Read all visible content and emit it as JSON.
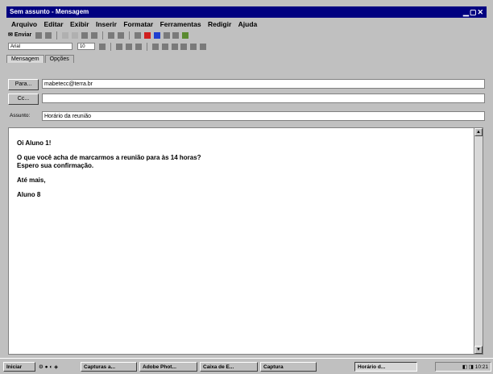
{
  "window": {
    "title": "Sem assunto - Mensagem",
    "controls": "▁▢✕"
  },
  "menu": [
    "Arquivo",
    "Editar",
    "Exibir",
    "Inserir",
    "Formatar",
    "Ferramentas",
    "Redigir",
    "Ajuda"
  ],
  "toolbar": {
    "send_label": "Enviar",
    "font_name": "Arial",
    "font_size": "10"
  },
  "tabs": [
    "Mensagem",
    "Opções"
  ],
  "header": {
    "to_label": "Para...",
    "to_value": "mabetecc@terra.br",
    "cc_label": "Cc...",
    "cc_value": "",
    "subject_label": "Assunto:",
    "subject_value": "Horário da reunião"
  },
  "message": {
    "lines": [
      "Oi Aluno 1!",
      "",
      "O que você acha de marcarmos a reunião para às 14 horas?",
      "Espero sua confirmação.",
      "",
      "Até mais,",
      "",
      "Aluno 8"
    ]
  },
  "taskbar": {
    "start_label": "Iniciar",
    "buttons": [
      "Capturas a...",
      "Adobe Phot...",
      "Caixa de E...",
      "Captura",
      "Horário d..."
    ],
    "clock": "10:21"
  }
}
